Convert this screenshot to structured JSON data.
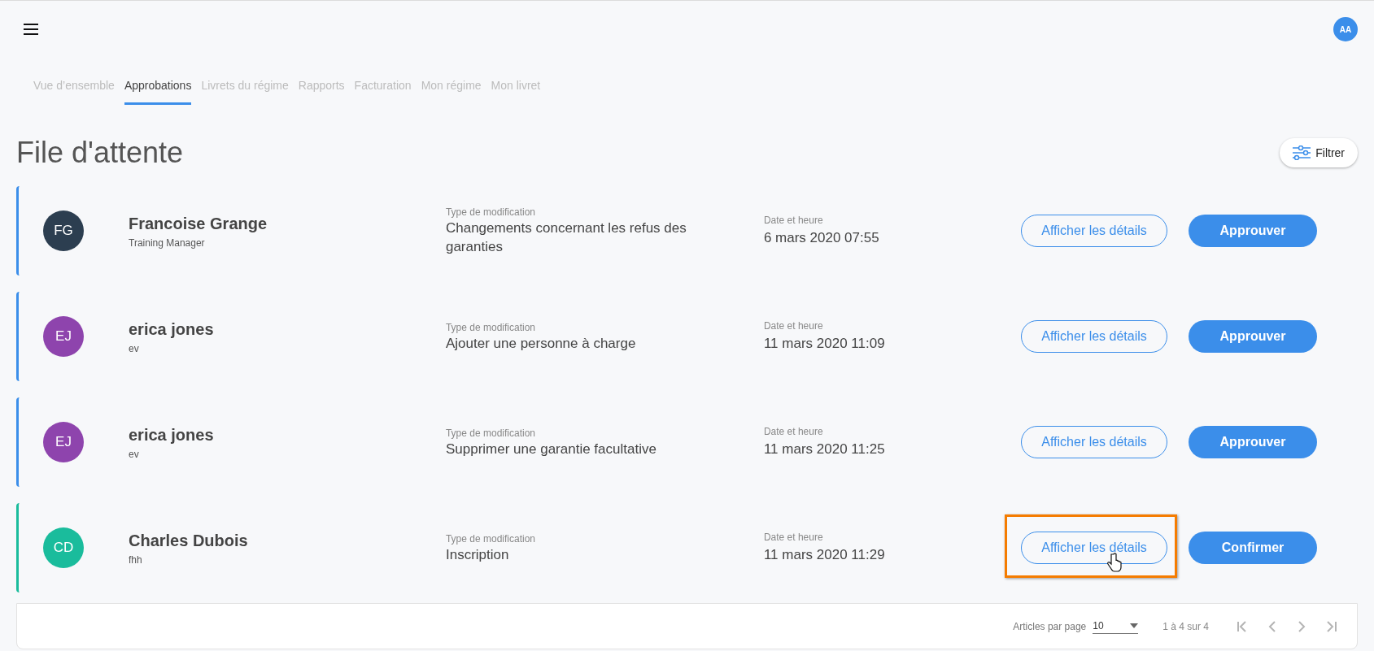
{
  "header": {
    "avatar_initials": "AA"
  },
  "tabs": [
    {
      "label": "Vue d’ensemble",
      "selected": false
    },
    {
      "label": "Approbations",
      "selected": true
    },
    {
      "label": "Livrets du régime",
      "selected": false
    },
    {
      "label": "Rapports",
      "selected": false
    },
    {
      "label": "Facturation",
      "selected": false
    },
    {
      "label": "Mon régime",
      "selected": false
    },
    {
      "label": "Mon livret",
      "selected": false
    }
  ],
  "title": "File d'attente",
  "filter_button": "Filtrer",
  "requests": [
    {
      "avatar": {
        "initials": "FG",
        "color": "#2c3e50"
      },
      "color": "#3b8eea",
      "name": "Francoise Grange",
      "role": "Training Manager",
      "type_label": "Type de modification",
      "type": "Changements concernant les refus des garanties",
      "date_label": "Date et heure",
      "date": "6 mars 2020 07:55",
      "details_button": "Afficher les détails",
      "action_button": "Approuver",
      "highlighted": false
    },
    {
      "avatar": {
        "initials": "EJ",
        "color": "#8e44ad"
      },
      "color": "#3b8eea",
      "name": "erica jones",
      "role": "ev",
      "type_label": "Type de modification",
      "type": "Ajouter une personne à charge",
      "date_label": "Date et heure",
      "date": "11 mars 2020 11:09",
      "details_button": "Afficher les détails",
      "action_button": "Approuver",
      "highlighted": false
    },
    {
      "avatar": {
        "initials": "EJ",
        "color": "#8e44ad"
      },
      "color": "#3b8eea",
      "name": "erica jones",
      "role": "ev",
      "type_label": "Type de modification",
      "type": "Supprimer une garantie facultative",
      "date_label": "Date et heure",
      "date": "11 mars 2020 11:25",
      "details_button": "Afficher les détails",
      "action_button": "Approuver",
      "highlighted": false
    },
    {
      "avatar": {
        "initials": "CD",
        "color": "#1abc9c"
      },
      "color": "#1abc9c",
      "name": "Charles Dubois",
      "role": "fhh",
      "type_label": "Type de modification",
      "type": "Inscription",
      "date_label": "Date et heure",
      "date": "11 mars 2020 11:29",
      "details_button": "Afficher les détails",
      "action_button": "Confirmer",
      "highlighted": true
    }
  ],
  "pagination": {
    "per_page_label": "Articles par page",
    "per_page": "10",
    "range": "1 à 4 sur 4"
  }
}
